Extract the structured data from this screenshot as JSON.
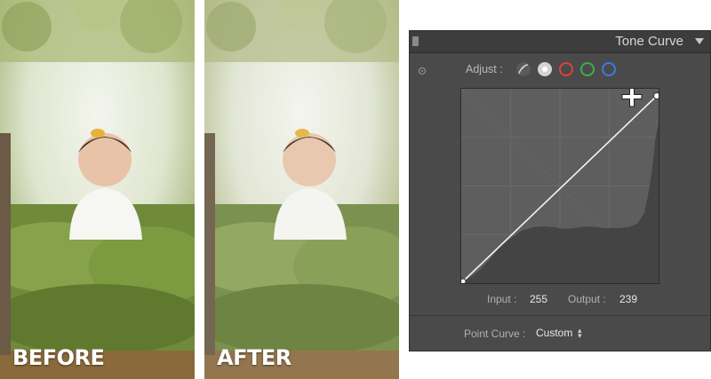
{
  "photos": {
    "before_label": "BEFORE",
    "after_label": "AFTER"
  },
  "panel": {
    "title": "Tone Curve",
    "adjust_label": "Adjust :",
    "channels": [
      "parametric-icon",
      "rgb-channel",
      "red-channel",
      "green-channel",
      "blue-channel"
    ],
    "readout": {
      "input_label": "Input :",
      "input_value": "255",
      "output_label": "Output :",
      "output_value": "239"
    },
    "point_curve": {
      "label": "Point Curve :",
      "value": "Custom"
    }
  },
  "colors": {
    "red": "#e0403a",
    "green": "#3fae49",
    "blue": "#3b7be6",
    "panel_bg": "#4a4a4a"
  },
  "curve": {
    "points": [
      [
        0,
        0
      ],
      [
        255,
        239
      ]
    ]
  }
}
